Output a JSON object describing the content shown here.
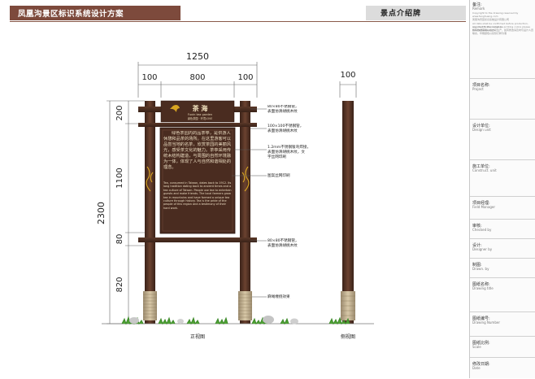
{
  "header": {
    "title": "凤凰沟景区标识系统设计方案",
    "section": "景点介绍牌"
  },
  "sidebar": {
    "remark": {
      "cn": "备注:",
      "en": "Remark"
    },
    "copyright_lines": [
      "Copyright to the drawing reserved by",
      "www.fenghuang.com",
      "凤凰沟景区标识系统设计有限公司",
      "All data shall be confirmed before production, any modification shall be",
      "reported to the designer, printing colors please take actual sample",
      "所有数据需确认后方可生产，如有修改请及时与设计人员联系，印刷颜色以实际打样为准"
    ],
    "fields": [
      {
        "cn": "项目名称:",
        "en": "Project"
      },
      {
        "cn": "设计单位:",
        "en": "Design unit"
      },
      {
        "cn": "施工单位:",
        "en": "Construct. unit"
      },
      {
        "cn": "项目经理:",
        "en": "Field Manager"
      },
      {
        "cn": "审核:",
        "en": "Checked by"
      },
      {
        "cn": "设计:",
        "en": "Designer by"
      },
      {
        "cn": "制图:",
        "en": "Drawn. by"
      },
      {
        "cn": "图纸名称:",
        "en": "Drawing title"
      },
      {
        "cn": "图纸编号:",
        "en": "Drawing Number"
      },
      {
        "cn": "图纸比例:",
        "en": "Scale"
      },
      {
        "cn": "修改日期:",
        "en": "Date"
      }
    ]
  },
  "drawing": {
    "dim_total_width": "1250",
    "dim_segments_top": [
      "100",
      "800",
      "100"
    ],
    "dim_side_width": "100",
    "dim_total_height": "2300",
    "dim_segments_vert": [
      "200",
      "1100",
      "80",
      "820"
    ],
    "sign_title": "茶 海",
    "sign_subtitle": "Fuxin tea garden",
    "sign_small": "绿色茶园 · 环境LOVE",
    "body_cn": "绿色茶园内的品茶亭，是供游人休憩和品茶的场所。在这里游客可以品尝当地的名茶，欣赏茶园的美丽风光，感受茶文化的魅力。茶亭采用传统木结构建造，与周围的自然环境融为一体，体现了人与自然和谐相处的理念。",
    "body_en": "Tea, consumed in Taiwan, dates back to 1912. Its long tradition dating back to ancient times and a tea culture of Taiwan. People use tea to entertain guests and make friends. The local farmers grow tea in mountains and have formed a unique tea culture through history. Tea is the pride of the people of this region and a testimony of their hard work.",
    "callouts": [
      "80×80不锈钢管，\n表面仿清胡桃木纹",
      "100×100不锈钢管，\n表面仿清胡桃木纹",
      "1.2mm不锈钢钣弯焊接，\n表面仿清胡桃木纹，文\n字丝网印刷",
      "图案丝网印刷",
      "80×80不锈钢管，\n表面仿清胡桃木纹",
      "麻绳缠绕效果"
    ],
    "label_front": "正视图",
    "label_side": "侧视图"
  }
}
